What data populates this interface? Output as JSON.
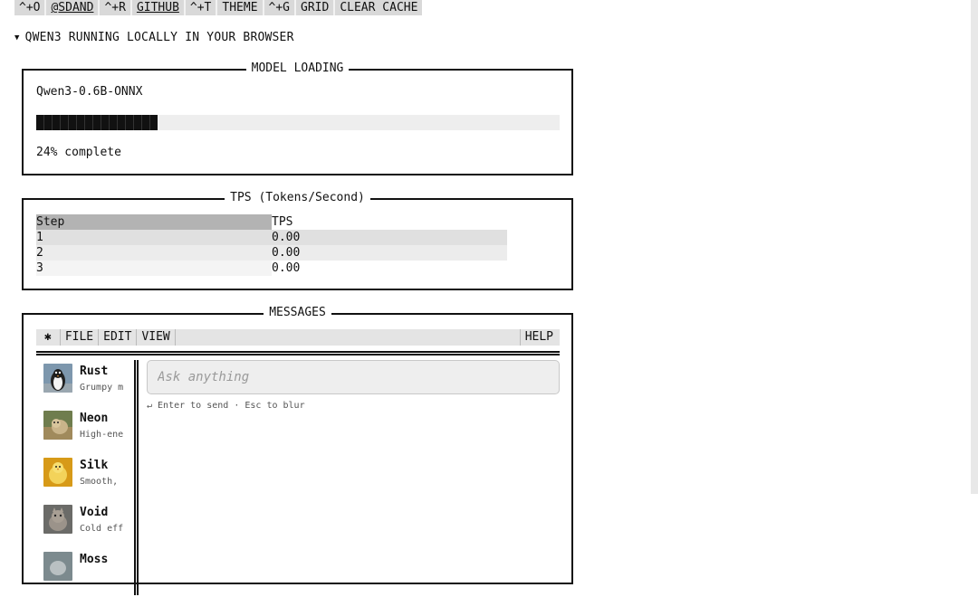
{
  "topbar": {
    "items": [
      "^+O",
      "@SDAND",
      "^+R",
      "GITHUB",
      "^+T",
      "THEME",
      "^+G",
      "GRID",
      "CLEAR CACHE"
    ]
  },
  "section": {
    "title": "QWEN3 RUNNING LOCALLY IN YOUR BROWSER",
    "toggle_icon": "triangle-down-icon"
  },
  "loading": {
    "title": "MODEL LOADING",
    "model_name": "Qwen3-0.6B-ONNX",
    "progress_fraction": 0.232,
    "status": "24% complete"
  },
  "tps": {
    "title": "TPS (Tokens/Second)",
    "headers": [
      "Step",
      "TPS"
    ],
    "rows": [
      [
        "1",
        "0.00"
      ],
      [
        "2",
        "0.00"
      ],
      [
        "3",
        "0.00"
      ]
    ]
  },
  "messages": {
    "title": "MESSAGES",
    "menu": {
      "star": "✱",
      "file": "FILE",
      "edit": "EDIT",
      "view": "VIEW",
      "help": "HELP"
    },
    "personas": [
      {
        "name": "Rust",
        "desc": "Grumpy m"
      },
      {
        "name": "Neon",
        "desc": "High-ene"
      },
      {
        "name": "Silk",
        "desc": "Smooth,"
      },
      {
        "name": "Void",
        "desc": "Cold eff"
      },
      {
        "name": "Moss",
        "desc": ""
      }
    ],
    "input_placeholder": "Ask anything",
    "hint": "↵ Enter to send · Esc to blur"
  },
  "colors": {
    "progress": "#111111",
    "panel_border": "#111111",
    "menubar": "#e4e4e4"
  }
}
